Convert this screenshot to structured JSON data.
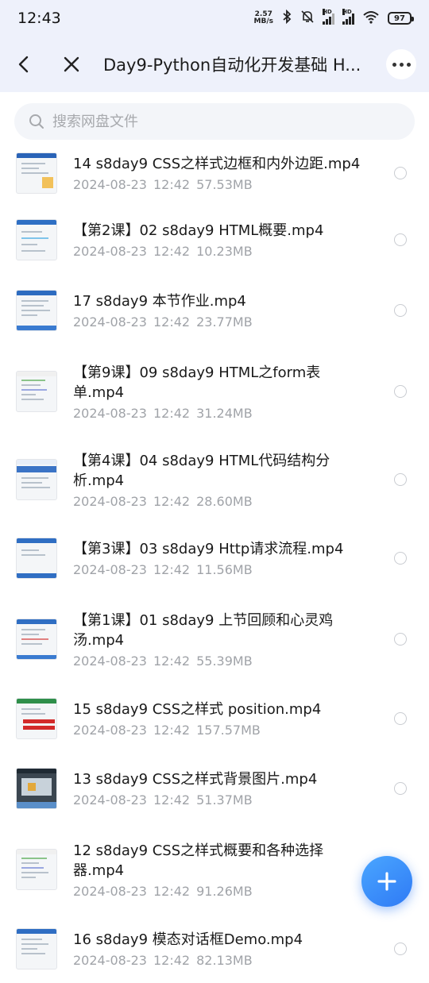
{
  "status": {
    "time": "12:43",
    "net_speed_value": "2.57",
    "net_speed_unit": "MB/s",
    "battery": "97"
  },
  "header": {
    "title": "Day9-Python自动化开发基础 H..."
  },
  "search": {
    "placeholder": "搜索网盘文件"
  },
  "files": [
    {
      "name": "14 s8day9 CSS之样式边框和内外边距.mp4",
      "date": "2024-08-23",
      "time": "12:42",
      "size": "57.53MB"
    },
    {
      "name": "【第2课】02 s8day9 HTML概要.mp4",
      "date": "2024-08-23",
      "time": "12:42",
      "size": "10.23MB"
    },
    {
      "name": "17 s8day9 本节作业.mp4",
      "date": "2024-08-23",
      "time": "12:42",
      "size": "23.77MB"
    },
    {
      "name": "【第9课】09 s8day9 HTML之form表单.mp4",
      "date": "2024-08-23",
      "time": "12:42",
      "size": "31.24MB"
    },
    {
      "name": "【第4课】04 s8day9 HTML代码结构分析.mp4",
      "date": "2024-08-23",
      "time": "12:42",
      "size": "28.60MB"
    },
    {
      "name": "【第3课】03 s8day9 Http请求流程.mp4",
      "date": "2024-08-23",
      "time": "12:42",
      "size": "11.56MB"
    },
    {
      "name": "【第1课】01 s8day9 上节回顾和心灵鸡汤.mp4",
      "date": "2024-08-23",
      "time": "12:42",
      "size": "55.39MB"
    },
    {
      "name": "15 s8day9 CSS之样式 position.mp4",
      "date": "2024-08-23",
      "time": "12:42",
      "size": "157.57MB"
    },
    {
      "name": "13 s8day9 CSS之样式背景图片.mp4",
      "date": "2024-08-23",
      "time": "12:42",
      "size": "51.37MB"
    },
    {
      "name": "12 s8day9 CSS之样式概要和各种选择器.mp4",
      "date": "2024-08-23",
      "time": "12:42",
      "size": "91.26MB"
    },
    {
      "name": "16 s8day9 模态对话框Demo.mp4",
      "date": "2024-08-23",
      "time": "12:42",
      "size": "82.13MB"
    }
  ],
  "colors": {
    "accent": "#2f7af5",
    "header_bg": "#eef1fb"
  }
}
